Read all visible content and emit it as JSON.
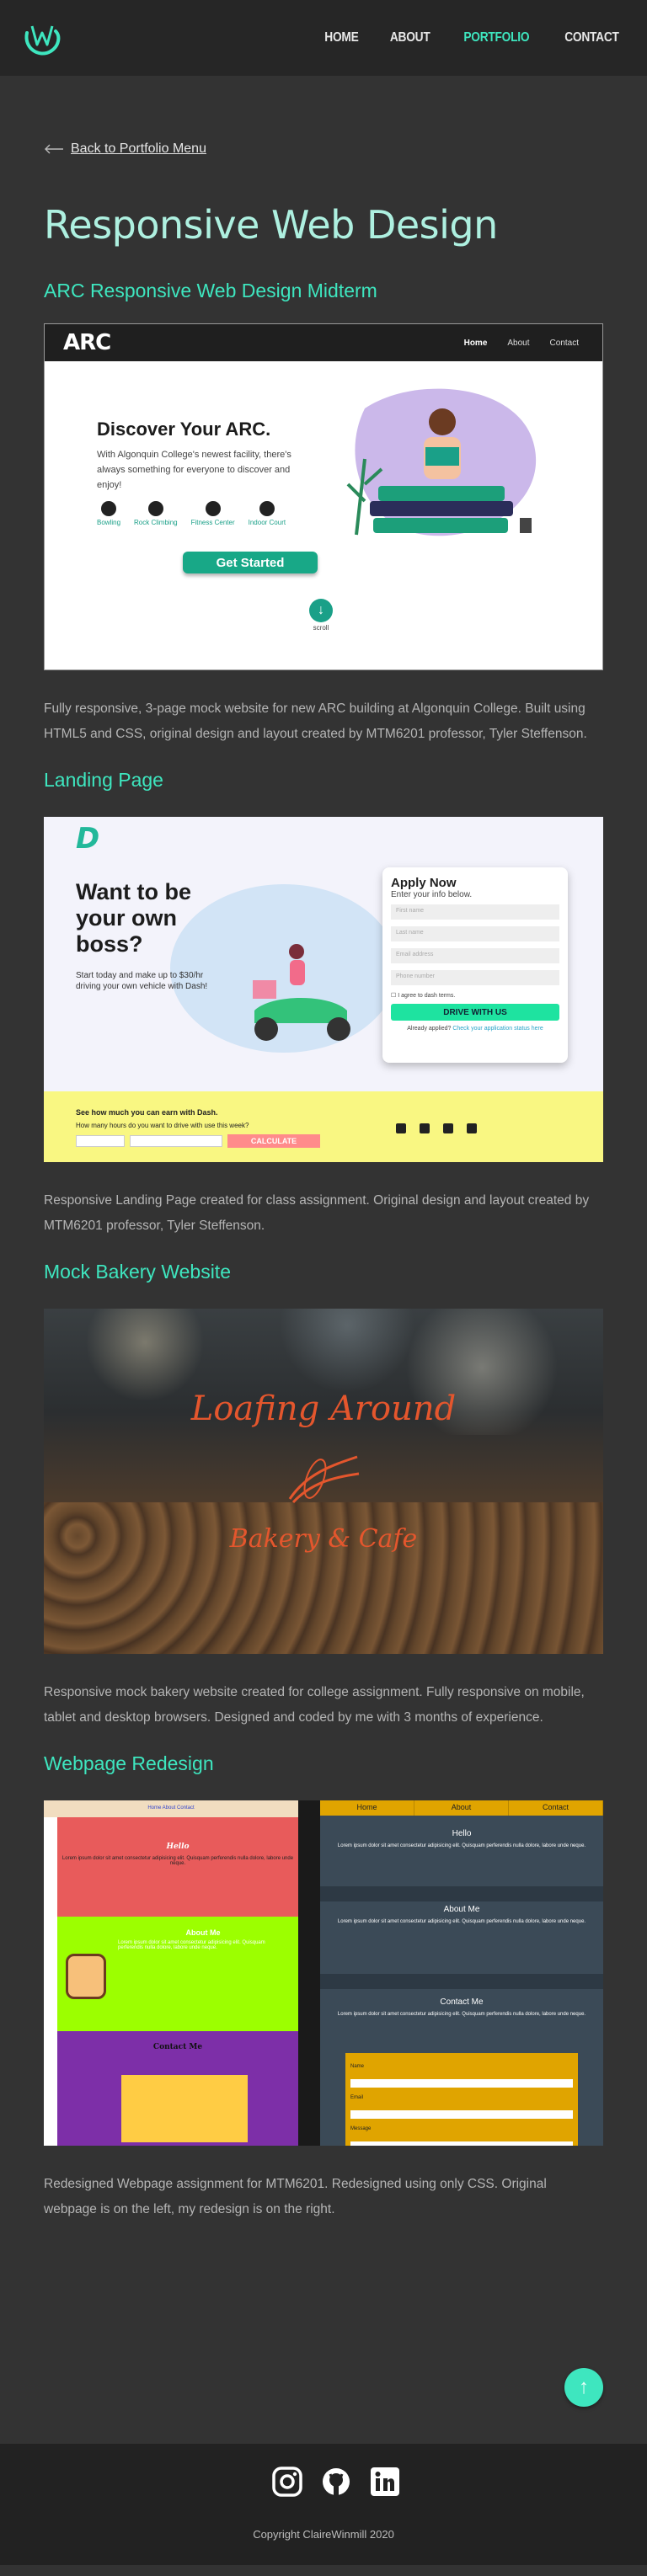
{
  "nav": {
    "logo_icon": "w-swirl-logo-icon",
    "links": [
      {
        "label": "HOME",
        "active": false
      },
      {
        "label": "ABOUT",
        "active": false
      },
      {
        "label": "PORTFOLIO",
        "active": true
      },
      {
        "label": "CONTACT",
        "active": false
      }
    ]
  },
  "back": {
    "label": "Back to Portfolio Menu",
    "icon": "left-arrow-icon"
  },
  "page_title": "Responsive Web Design",
  "projects": [
    {
      "title": "ARC Responsive Web Design Midterm",
      "description": "Fully responsive, 3-page mock website for new ARC building at Algonquin College. Built using HTML5 and CSS, original design and layout created by MTM6201 professor, Tyler Steffenson.",
      "screenshot": {
        "logo": "ARC",
        "nav": [
          "Home",
          "About",
          "Contact"
        ],
        "heading": "Discover Your ARC.",
        "text": "With Algonquin College's newest facility, there's always something for everyone to discover and enjoy!",
        "activities": [
          "Bowling",
          "Rock Climbing",
          "Fitness Center",
          "Indoor Court"
        ],
        "button": "Get Started",
        "scroll": "scroll"
      }
    },
    {
      "title": "Landing Page",
      "description": "Responsive Landing Page created for class assignment. Original design and layout created by MTM6201 professor, Tyler Steffenson.",
      "screenshot": {
        "logo": "D",
        "heading": "Want to be your own boss?",
        "text": "Start today and make up to $30/hr driving your own vehicle with Dash!",
        "form_title": "Apply Now",
        "form_sub": "Enter your info below.",
        "fields": [
          "First name",
          "Last name",
          "Email address",
          "Phone number"
        ],
        "checkbox": "I agree to dash terms.",
        "form_button": "DRIVE WITH US",
        "applied": "Already applied?",
        "applied_link": "Check your application status here",
        "earn_title": "See how much you can earn with Dash.",
        "earn_q": "How many hours do you want to drive with use this week?",
        "calc": "CALCULATE"
      }
    },
    {
      "title": "Mock Bakery Website",
      "description": "Responsive mock bakery website created for college assignment. Fully responsive on mobile, tablet and desktop browsers. Designed and coded by me with 3 months of experience.",
      "screenshot": {
        "name": "Loafing Around",
        "sub": "Bakery & Cafe"
      }
    },
    {
      "title": "Webpage Redesign",
      "description": "Redesigned Webpage assignment for MTM6201. Redesigned using only CSS. Original webpage is on the left, my redesign is on the right.",
      "screenshot": {
        "old_nav": "Home   About   Contact",
        "old_hello": "Hello",
        "old_about": "About Me",
        "old_contact": "Contact Me",
        "new_nav": [
          "Home",
          "About",
          "Contact"
        ],
        "new_hello": "Hello",
        "new_about": "About Me",
        "new_contact": "Contact Me",
        "new_fields": [
          "Name",
          "Email",
          "Message"
        ],
        "lorem": "Lorem ipsum dolor sit amet consectetur adipisicing elit. Quisquam perferendis nulla dolore, labore unde neque."
      }
    }
  ],
  "top_button": {
    "icon": "arrow-up-icon"
  },
  "footer": {
    "icons": [
      "instagram-icon",
      "github-icon",
      "linkedin-icon"
    ],
    "copyright": "Copyright ClaireWinmill 2020"
  },
  "colors": {
    "accent": "#3ee6bf",
    "title": "#aef0e0",
    "background": "#333333",
    "nav": "#262626"
  }
}
